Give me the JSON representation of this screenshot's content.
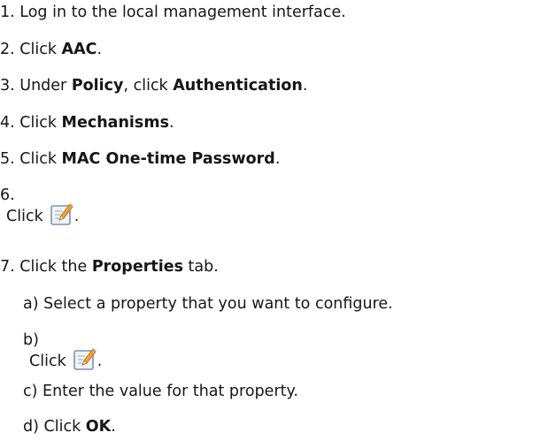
{
  "steps": [
    {
      "num": "1.",
      "text": "Log in to the local management interface."
    },
    {
      "num": "2.",
      "pre": "Click ",
      "bold": "AAC",
      "post": "."
    },
    {
      "num": "3.",
      "pre": "Under ",
      "bold": "Policy",
      "mid": ", click ",
      "bold2": "Authentication",
      "post": "."
    },
    {
      "num": "4.",
      "pre": "Click ",
      "bold": "Mechanisms",
      "post": "."
    },
    {
      "num": "5.",
      "pre": "Click ",
      "bold": "MAC One-time Password",
      "post": "."
    },
    {
      "num": "6.",
      "pre": "Click",
      "post": "."
    },
    {
      "num": "7.",
      "pre": "Click the ",
      "bold": "Properties",
      "post": " tab."
    }
  ],
  "substeps": [
    {
      "num": "a)",
      "text": "Select a property that you want to configure."
    },
    {
      "num": "b)",
      "pre": "Click",
      "post": "."
    },
    {
      "num": "c)",
      "text": "Enter the value for that property."
    },
    {
      "num": "d)",
      "pre": "Click ",
      "bold": "OK",
      "post": "."
    }
  ],
  "icons": {
    "edit": "edit-icon"
  },
  "colors": {
    "text": "#161616",
    "icon_frame": "#7c93ad",
    "icon_pencil": "#f0a33a",
    "icon_bg": "#eef3f8"
  }
}
